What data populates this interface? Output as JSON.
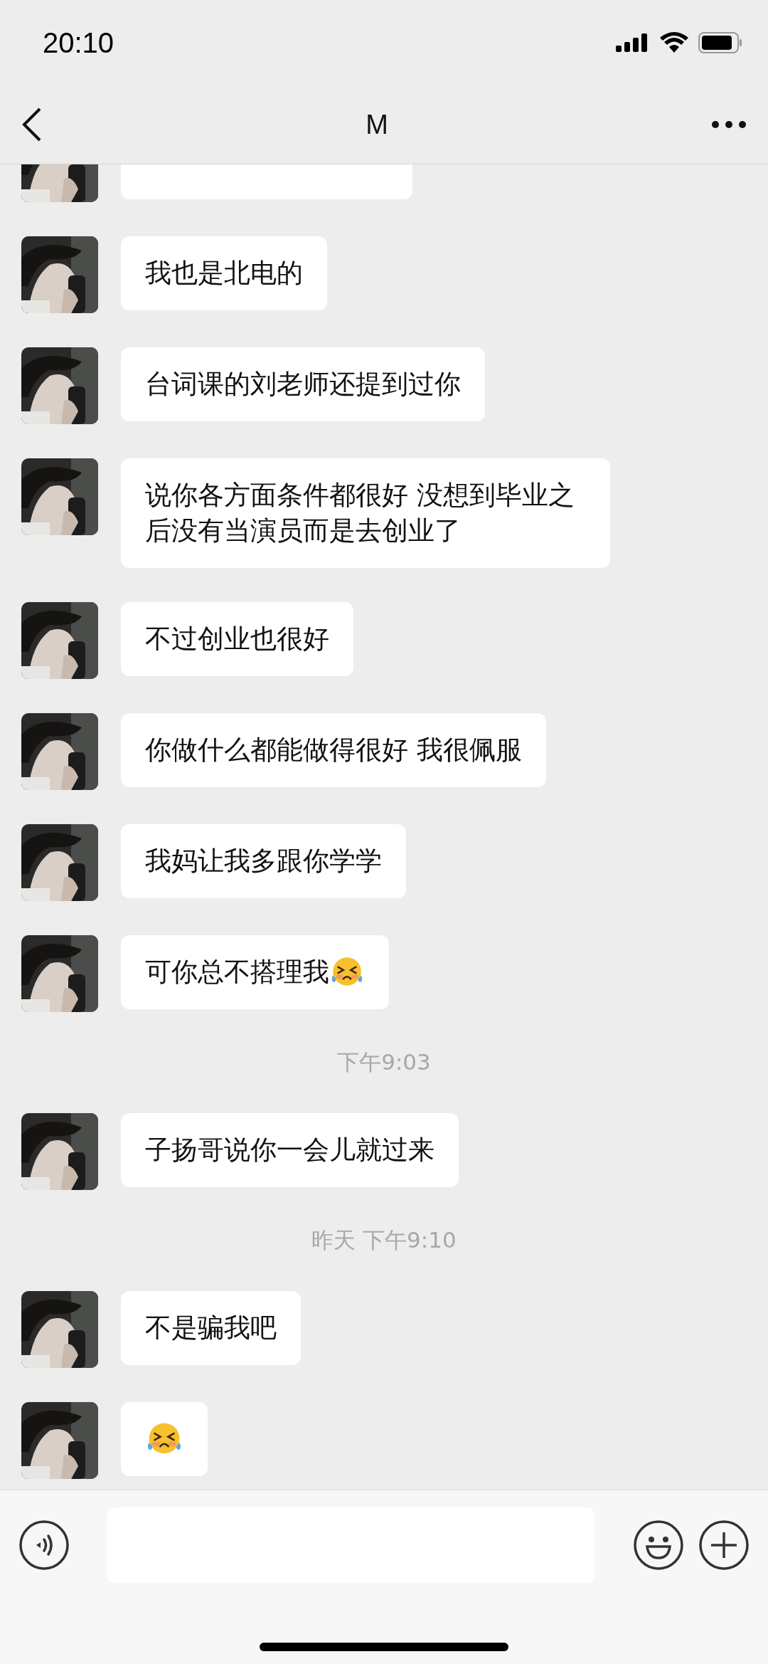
{
  "status_bar": {
    "time": "20:10"
  },
  "nav": {
    "title": "M"
  },
  "messages": [
    {
      "kind": "covered"
    },
    {
      "kind": "text",
      "text": "我也是北电的",
      "trailing_emoji": false
    },
    {
      "kind": "text",
      "text": "台词课的刘老师还提到过你",
      "trailing_emoji": false
    },
    {
      "kind": "text",
      "text": "说你各方面条件都很好 没想到毕业之后没有当演员而是去创业了",
      "trailing_emoji": false
    },
    {
      "kind": "text",
      "text": "不过创业也很好",
      "trailing_emoji": false
    },
    {
      "kind": "text",
      "text": "你做什么都能做得很好 我很佩服",
      "trailing_emoji": false
    },
    {
      "kind": "text",
      "text": "我妈让我多跟你学学",
      "trailing_emoji": false
    },
    {
      "kind": "text",
      "text": "可你总不搭理我",
      "trailing_emoji": true
    },
    {
      "kind": "time",
      "text": "下午9:03"
    },
    {
      "kind": "text",
      "text": "子扬哥说你一会儿就过来",
      "trailing_emoji": false
    },
    {
      "kind": "time",
      "text": "昨天 下午9:10"
    },
    {
      "kind": "text",
      "text": "不是骗我吧",
      "trailing_emoji": false
    },
    {
      "kind": "emoji"
    }
  ]
}
